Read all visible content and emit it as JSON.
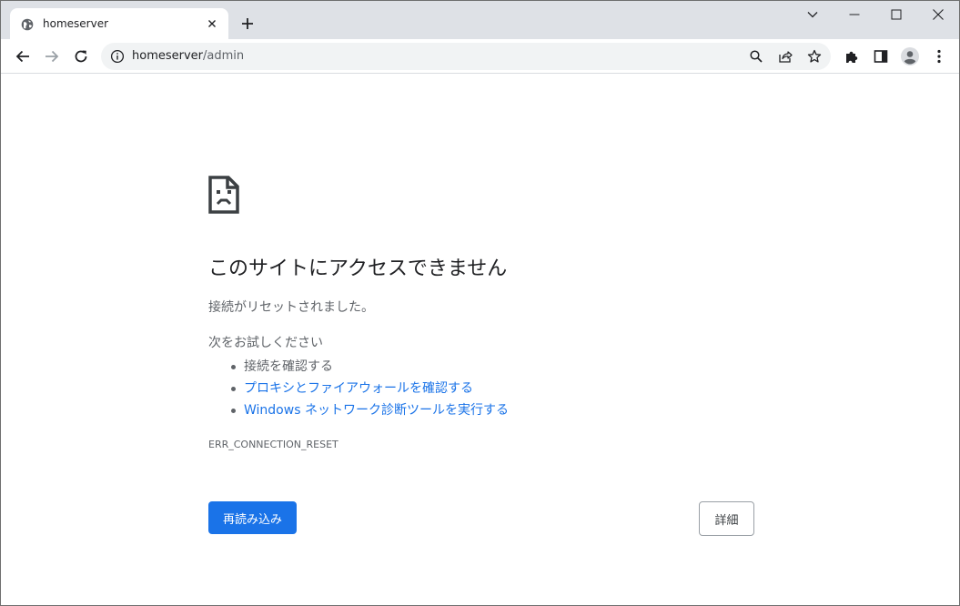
{
  "tab": {
    "title": "homeserver",
    "favicon": "globe-icon"
  },
  "address": {
    "host": "homeserver",
    "path": "/admin"
  },
  "error": {
    "title": "このサイトにアクセスできません",
    "subtitle": "接続がリセットされました。",
    "try_heading": "次をお試しください",
    "suggestions": [
      "接続を確認する",
      "プロキシとファイアウォールを確認する",
      "Windows ネットワーク診断ツールを実行する"
    ],
    "code": "ERR_CONNECTION_RESET"
  },
  "buttons": {
    "reload": "再読み込み",
    "details": "詳細"
  },
  "colors": {
    "accent": "#1a73e8",
    "tabstrip": "#dee1e6",
    "text_secondary": "#5f6368"
  }
}
